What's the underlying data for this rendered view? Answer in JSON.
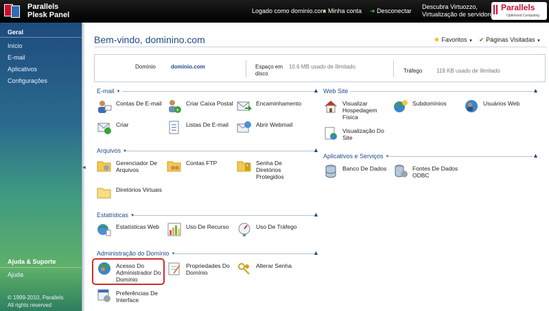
{
  "topbar": {
    "brand_line1": "Parallels",
    "brand_line2": "Plesk Panel",
    "logged_in": "Logado como dominio.com",
    "my_account": "Minha conta",
    "logout": "Desconectar",
    "promo_line1": "Descubra Virtuozzo,",
    "promo_line2": "Virtualização de servidores",
    "badge": "Parallels",
    "badge_sub": "Optimized Computing"
  },
  "sidebar": {
    "section_geral": "Geral",
    "items": [
      "Início",
      "E-mail",
      "Aplicativos",
      "Configurações"
    ],
    "section_help": "Ajuda & Suporte",
    "help_item": "Ajuda",
    "copyright_line1": "© 1999-2010, Parallels",
    "copyright_line2": "All rights reserved"
  },
  "header": {
    "welcome": "Bem-vindo, dominino.com",
    "favorites": "Favoritos",
    "visited": "Páginas Visitadas"
  },
  "info": {
    "domain_label": "Domínio",
    "domain_value": "dominio.com",
    "space_label_1": "Espaço em",
    "space_label_2": "disco",
    "space_value": "10.6 MB usado de Ilimitado",
    "traffic_label": "Tráfego",
    "traffic_value": "119 KB usado de Ilimitado"
  },
  "sections": {
    "email": "E-mail",
    "files": "Arquivos",
    "stats": "Estatísticas",
    "admin": "Administração do Domínio",
    "website": "Web Site",
    "apps": "Aplicativos e Serviços"
  },
  "tiles": {
    "email_accounts": "Contas De E-mail",
    "create_mailbox": "Criar Caixa Postal",
    "forwarding": "Encaminhamento",
    "create": "Criar",
    "mailing_lists": "Listas De E-mail",
    "webmail": "Abrir Webmail",
    "file_manager_1": "Gerenciador De",
    "file_manager_2": "Arquivos",
    "ftp": "Contas FTP",
    "dir_pass_1": "Senha De",
    "dir_pass_2": "Diretórios",
    "dir_pass_3": "Protegidos",
    "virtual_dirs": "Diretórios Virtuais",
    "web_stats": "Estatísticas Web",
    "resource_usage": "Uso De Recurso",
    "traffic_usage": "Uso De Tráfego",
    "admin_access_1": "Acesso Do",
    "admin_access_2": "Administrador Do",
    "admin_access_3": "Domínio",
    "domain_props_1": "Propriedades Do",
    "domain_props_2": "Domínio",
    "change_pass": "Alterar Senha",
    "iface_prefs_1": "Preferências De",
    "iface_prefs_2": "Interface",
    "view_hosting_1": "Visualizar",
    "view_hosting_2": "Hospedagem",
    "view_hosting_3": "Física",
    "subdomains": "Subdomínios",
    "web_users": "Usuários Web",
    "site_preview_1": "Visualização Do",
    "site_preview_2": "Site",
    "databases": "Banco De Dados",
    "odbc_1": "Fontes De Dados",
    "odbc_2": "ODBC"
  }
}
